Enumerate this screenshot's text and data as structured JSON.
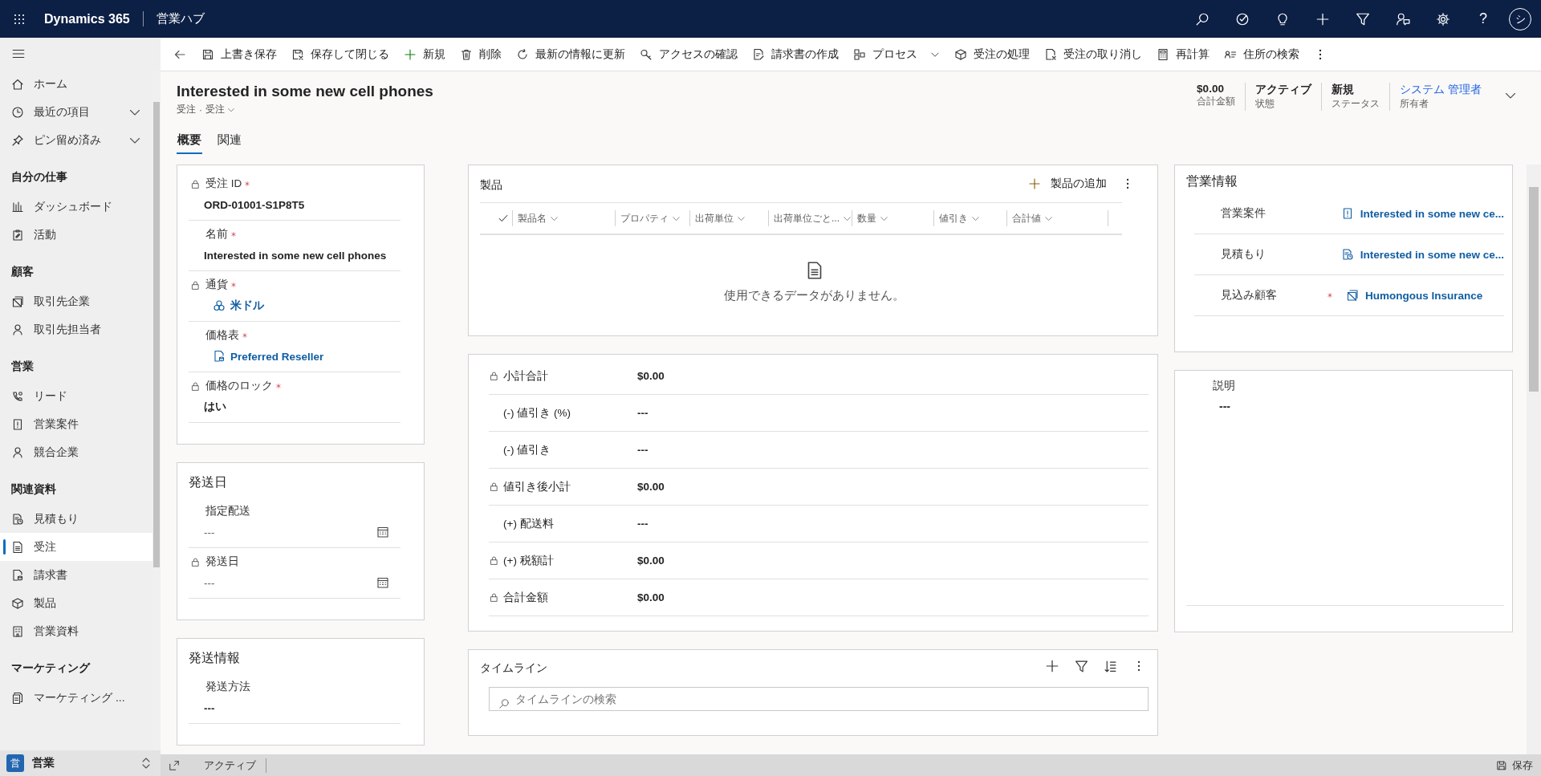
{
  "top_bar": {
    "app_name": "Dynamics 365",
    "app_area": "営業ハブ",
    "help": "?",
    "avatar_initial": "シ"
  },
  "sidebar": {
    "top_items": [
      {
        "label": "ホーム",
        "expandable": false
      },
      {
        "label": "最近の項目",
        "expandable": true
      },
      {
        "label": "ピン留め済み",
        "expandable": true
      }
    ],
    "groups": [
      {
        "title": "自分の仕事",
        "items": [
          {
            "label": "ダッシュボード",
            "selected": false
          },
          {
            "label": "活動",
            "selected": false
          }
        ]
      },
      {
        "title": "顧客",
        "items": [
          {
            "label": "取引先企業",
            "selected": false
          },
          {
            "label": "取引先担当者",
            "selected": false
          }
        ]
      },
      {
        "title": "営業",
        "items": [
          {
            "label": "リード",
            "selected": false
          },
          {
            "label": "営業案件",
            "selected": false
          },
          {
            "label": "競合企業",
            "selected": false
          }
        ]
      },
      {
        "title": "関連資料",
        "items": [
          {
            "label": "見積もり",
            "selected": false
          },
          {
            "label": "受注",
            "selected": true
          },
          {
            "label": "請求書",
            "selected": false
          },
          {
            "label": "製品",
            "selected": false
          },
          {
            "label": "営業資料",
            "selected": false
          }
        ]
      },
      {
        "title": "マーケティング",
        "items": [
          {
            "label": "マーケティング ...",
            "selected": false
          }
        ]
      }
    ],
    "area": {
      "badge": "営",
      "label": "営業"
    }
  },
  "command_bar": {
    "commands": [
      {
        "label": "上書き保存",
        "dropdown": false
      },
      {
        "label": "保存して閉じる",
        "dropdown": false
      },
      {
        "label": "新規",
        "dropdown": false
      },
      {
        "label": "削除",
        "dropdown": false
      },
      {
        "label": "最新の情報に更新",
        "dropdown": false
      },
      {
        "label": "アクセスの確認",
        "dropdown": false
      },
      {
        "label": "請求書の作成",
        "dropdown": false
      },
      {
        "label": "プロセス",
        "dropdown": true
      },
      {
        "label": "受注の処理",
        "dropdown": false
      },
      {
        "label": "受注の取り消し",
        "dropdown": false
      },
      {
        "label": "再計算",
        "dropdown": false
      },
      {
        "label": "住所の検索",
        "dropdown": false
      }
    ]
  },
  "record_header": {
    "title": "Interested in some new cell phones",
    "entity": "受注",
    "separator": "·",
    "form": "受注",
    "fields": [
      {
        "value": "$0.00",
        "label": "合計金額",
        "kind": "text"
      },
      {
        "value": "アクティブ",
        "label": "状態",
        "kind": "text"
      },
      {
        "value": "新規",
        "label": "ステータス",
        "kind": "text"
      },
      {
        "value": "システム 管理者",
        "label": "所有者",
        "kind": "link"
      }
    ]
  },
  "tabs": [
    {
      "label": "概要",
      "selected": true
    },
    {
      "label": "関連",
      "selected": false
    }
  ],
  "left_sections": [
    {
      "fields": [
        {
          "label": "受注 ID",
          "locked": true,
          "required": true,
          "kind": "text",
          "value": "ORD-01001-S1P8T5"
        },
        {
          "label": "名前",
          "locked": false,
          "required": true,
          "kind": "text",
          "value": "Interested in some new cell phones"
        },
        {
          "label": "通貨",
          "locked": true,
          "required": true,
          "kind": "lookup",
          "value": "米ドル"
        },
        {
          "label": "価格表",
          "locked": false,
          "required": true,
          "kind": "lookup",
          "value": "Preferred Reseller"
        },
        {
          "label": "価格のロック",
          "locked": true,
          "required": true,
          "kind": "text",
          "value": "はい"
        }
      ]
    },
    {
      "title": "発送日",
      "fields": [
        {
          "label": "指定配送",
          "locked": false,
          "required": false,
          "kind": "date",
          "value": "---"
        },
        {
          "label": "発送日",
          "locked": true,
          "required": false,
          "kind": "date",
          "value": "---"
        }
      ]
    },
    {
      "title": "発送情報",
      "fields": [
        {
          "label": "発送方法",
          "locked": false,
          "required": false,
          "kind": "text",
          "value": "---"
        }
      ]
    }
  ],
  "products": {
    "title": "製品",
    "add_label": "製品の追加",
    "columns": [
      {
        "label": "製品名"
      },
      {
        "label": "プロパティ"
      },
      {
        "label": "出荷単位"
      },
      {
        "label": "出荷単位ごと..."
      },
      {
        "label": "数量"
      },
      {
        "label": "値引き"
      },
      {
        "label": "合計値"
      }
    ],
    "empty_message": "使用できるデータがありません。"
  },
  "totals": [
    {
      "label": "小計合計",
      "locked": true,
      "value": "$0.00"
    },
    {
      "label": "(-) 値引き (%)",
      "locked": false,
      "value": "---"
    },
    {
      "label": "(-) 値引き",
      "locked": false,
      "value": "---"
    },
    {
      "label": "値引き後小計",
      "locked": true,
      "value": "$0.00"
    },
    {
      "label": "(+) 配送料",
      "locked": false,
      "value": "---"
    },
    {
      "label": "(+) 税額計",
      "locked": true,
      "value": "$0.00"
    },
    {
      "label": "合計金額",
      "locked": true,
      "value": "$0.00"
    }
  ],
  "timeline": {
    "title": "タイムライン",
    "search_placeholder": "タイムラインの検索"
  },
  "sales_info": {
    "title": "営業情報",
    "rows": [
      {
        "label": "営業案件",
        "required": false,
        "value": "Interested in some new ce..."
      },
      {
        "label": "見積もり",
        "required": false,
        "value": "Interested in some new ce..."
      },
      {
        "label": "見込み顧客",
        "required": true,
        "value": "Humongous Insurance"
      }
    ]
  },
  "description": {
    "label": "説明",
    "value": "---"
  },
  "status_bar": {
    "status": "アクティブ",
    "save_label": "保存"
  }
}
